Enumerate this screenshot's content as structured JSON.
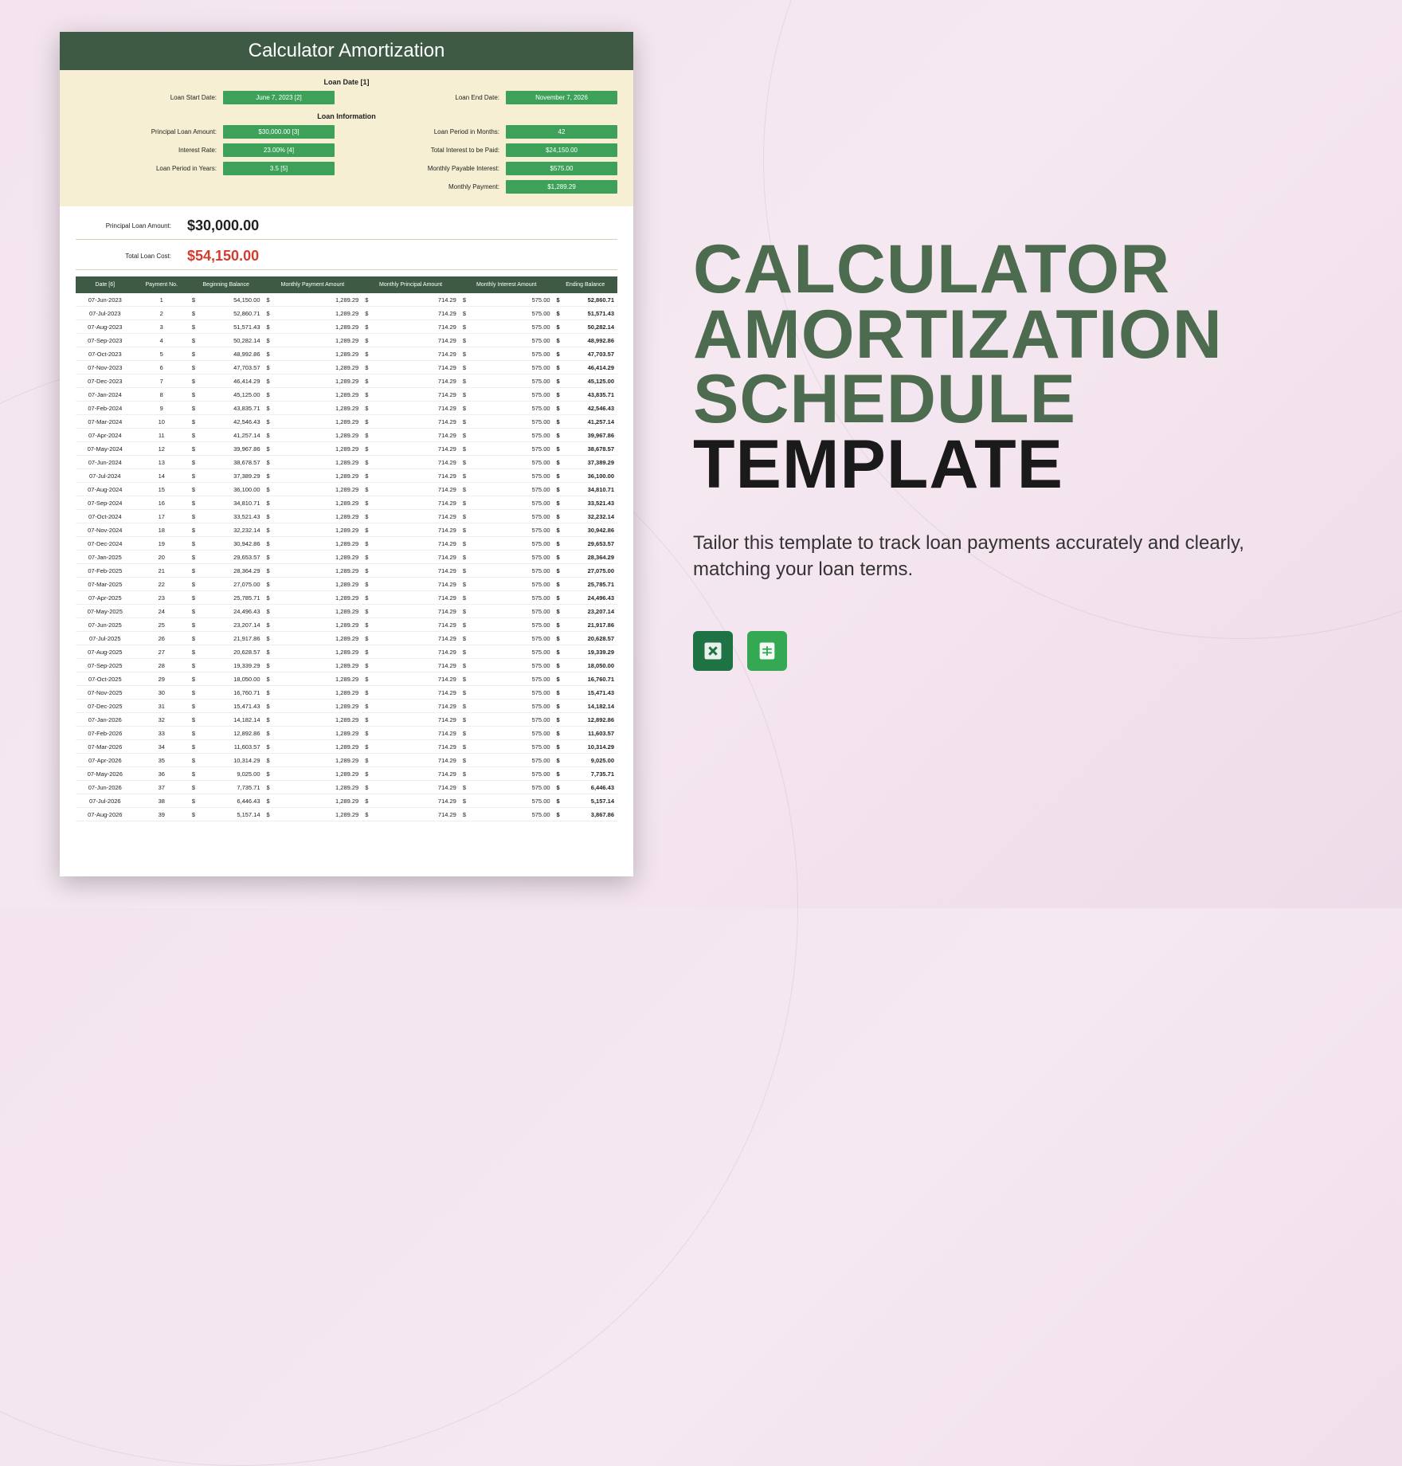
{
  "marketing": {
    "title_line1": "CALCULATOR",
    "title_line2": "AMORTIZATION",
    "title_line3": "SCHEDULE",
    "title_line4": "TEMPLATE",
    "tagline": "Tailor this template to track loan payments accurately and clearly, matching your loan terms.",
    "icons": {
      "excel": "excel-icon",
      "sheets": "google-sheets-icon"
    }
  },
  "doc": {
    "header": "Calculator Amortization",
    "loan_date_section": "Loan Date [1]",
    "loan_info_section": "Loan Information",
    "fields_left_date": {
      "label": "Loan Start Date:",
      "value": "June 7, 2023 [2]"
    },
    "fields_right_date": {
      "label": "Loan End Date:",
      "value": "November 7, 2026"
    },
    "info_left": [
      {
        "label": "Principal Loan Amount:",
        "value": "$30,000.00 [3]"
      },
      {
        "label": "Interest Rate:",
        "value": "23.00% [4]"
      },
      {
        "label": "Loan Period in Years:",
        "value": "3.5 [5]"
      }
    ],
    "info_right": [
      {
        "label": "Loan Period in Months:",
        "value": "42"
      },
      {
        "label": "Total Interest to be Paid:",
        "value": "$24,150.00"
      },
      {
        "label": "Monthly Payable Interest:",
        "value": "$575.00"
      },
      {
        "label": "Monthly Payment:",
        "value": "$1,289.29"
      }
    ],
    "summary": {
      "principal_label": "Principal Loan Amount:",
      "principal_value": "$30,000.00",
      "total_label": "Total Loan Cost:",
      "total_value": "$54,150.00"
    },
    "table": {
      "headers": [
        "Date [6]",
        "Payment No.",
        "Beginning Balance",
        "Monthly Payment Amount",
        "Monthly Principal Amount",
        "Monthly Interest Amount",
        "Ending Balance"
      ],
      "rows": [
        {
          "date": "07-Jun-2023",
          "no": 1,
          "bb": "54,150.00",
          "mp": "1,289.29",
          "mpr": "714.29",
          "mi": "575.00",
          "eb": "52,860.71"
        },
        {
          "date": "07-Jul-2023",
          "no": 2,
          "bb": "52,860.71",
          "mp": "1,289.29",
          "mpr": "714.29",
          "mi": "575.00",
          "eb": "51,571.43"
        },
        {
          "date": "07-Aug-2023",
          "no": 3,
          "bb": "51,571.43",
          "mp": "1,289.29",
          "mpr": "714.29",
          "mi": "575.00",
          "eb": "50,282.14"
        },
        {
          "date": "07-Sep-2023",
          "no": 4,
          "bb": "50,282.14",
          "mp": "1,289.29",
          "mpr": "714.29",
          "mi": "575.00",
          "eb": "48,992.86"
        },
        {
          "date": "07-Oct-2023",
          "no": 5,
          "bb": "48,992.86",
          "mp": "1,289.29",
          "mpr": "714.29",
          "mi": "575.00",
          "eb": "47,703.57"
        },
        {
          "date": "07-Nov-2023",
          "no": 6,
          "bb": "47,703.57",
          "mp": "1,289.29",
          "mpr": "714.29",
          "mi": "575.00",
          "eb": "46,414.29"
        },
        {
          "date": "07-Dec-2023",
          "no": 7,
          "bb": "46,414.29",
          "mp": "1,289.29",
          "mpr": "714.29",
          "mi": "575.00",
          "eb": "45,125.00"
        },
        {
          "date": "07-Jan-2024",
          "no": 8,
          "bb": "45,125.00",
          "mp": "1,289.29",
          "mpr": "714.29",
          "mi": "575.00",
          "eb": "43,835.71"
        },
        {
          "date": "07-Feb-2024",
          "no": 9,
          "bb": "43,835.71",
          "mp": "1,289.29",
          "mpr": "714.29",
          "mi": "575.00",
          "eb": "42,546.43"
        },
        {
          "date": "07-Mar-2024",
          "no": 10,
          "bb": "42,546.43",
          "mp": "1,289.29",
          "mpr": "714.29",
          "mi": "575.00",
          "eb": "41,257.14"
        },
        {
          "date": "07-Apr-2024",
          "no": 11,
          "bb": "41,257.14",
          "mp": "1,289.29",
          "mpr": "714.29",
          "mi": "575.00",
          "eb": "39,967.86"
        },
        {
          "date": "07-May-2024",
          "no": 12,
          "bb": "39,967.86",
          "mp": "1,289.29",
          "mpr": "714.29",
          "mi": "575.00",
          "eb": "38,678.57"
        },
        {
          "date": "07-Jun-2024",
          "no": 13,
          "bb": "38,678.57",
          "mp": "1,289.29",
          "mpr": "714.29",
          "mi": "575.00",
          "eb": "37,389.29"
        },
        {
          "date": "07-Jul-2024",
          "no": 14,
          "bb": "37,389.29",
          "mp": "1,289.29",
          "mpr": "714.29",
          "mi": "575.00",
          "eb": "36,100.00"
        },
        {
          "date": "07-Aug-2024",
          "no": 15,
          "bb": "36,100.00",
          "mp": "1,289.29",
          "mpr": "714.29",
          "mi": "575.00",
          "eb": "34,810.71"
        },
        {
          "date": "07-Sep-2024",
          "no": 16,
          "bb": "34,810.71",
          "mp": "1,289.29",
          "mpr": "714.29",
          "mi": "575.00",
          "eb": "33,521.43"
        },
        {
          "date": "07-Oct-2024",
          "no": 17,
          "bb": "33,521.43",
          "mp": "1,289.29",
          "mpr": "714.29",
          "mi": "575.00",
          "eb": "32,232.14"
        },
        {
          "date": "07-Nov-2024",
          "no": 18,
          "bb": "32,232.14",
          "mp": "1,289.29",
          "mpr": "714.29",
          "mi": "575.00",
          "eb": "30,942.86"
        },
        {
          "date": "07-Dec-2024",
          "no": 19,
          "bb": "30,942.86",
          "mp": "1,289.29",
          "mpr": "714.29",
          "mi": "575.00",
          "eb": "29,653.57"
        },
        {
          "date": "07-Jan-2025",
          "no": 20,
          "bb": "29,653.57",
          "mp": "1,289.29",
          "mpr": "714.29",
          "mi": "575.00",
          "eb": "28,364.29"
        },
        {
          "date": "07-Feb-2025",
          "no": 21,
          "bb": "28,364.29",
          "mp": "1,289.29",
          "mpr": "714.29",
          "mi": "575.00",
          "eb": "27,075.00"
        },
        {
          "date": "07-Mar-2025",
          "no": 22,
          "bb": "27,075.00",
          "mp": "1,289.29",
          "mpr": "714.29",
          "mi": "575.00",
          "eb": "25,785.71"
        },
        {
          "date": "07-Apr-2025",
          "no": 23,
          "bb": "25,785.71",
          "mp": "1,289.29",
          "mpr": "714.29",
          "mi": "575.00",
          "eb": "24,496.43"
        },
        {
          "date": "07-May-2025",
          "no": 24,
          "bb": "24,496.43",
          "mp": "1,289.29",
          "mpr": "714.29",
          "mi": "575.00",
          "eb": "23,207.14"
        },
        {
          "date": "07-Jun-2025",
          "no": 25,
          "bb": "23,207.14",
          "mp": "1,289.29",
          "mpr": "714.29",
          "mi": "575.00",
          "eb": "21,917.86"
        },
        {
          "date": "07-Jul-2025",
          "no": 26,
          "bb": "21,917.86",
          "mp": "1,289.29",
          "mpr": "714.29",
          "mi": "575.00",
          "eb": "20,628.57"
        },
        {
          "date": "07-Aug-2025",
          "no": 27,
          "bb": "20,628.57",
          "mp": "1,289.29",
          "mpr": "714.29",
          "mi": "575.00",
          "eb": "19,339.29"
        },
        {
          "date": "07-Sep-2025",
          "no": 28,
          "bb": "19,339.29",
          "mp": "1,289.29",
          "mpr": "714.29",
          "mi": "575.00",
          "eb": "18,050.00"
        },
        {
          "date": "07-Oct-2025",
          "no": 29,
          "bb": "18,050.00",
          "mp": "1,289.29",
          "mpr": "714.29",
          "mi": "575.00",
          "eb": "16,760.71"
        },
        {
          "date": "07-Nov-2025",
          "no": 30,
          "bb": "16,760.71",
          "mp": "1,289.29",
          "mpr": "714.29",
          "mi": "575.00",
          "eb": "15,471.43"
        },
        {
          "date": "07-Dec-2025",
          "no": 31,
          "bb": "15,471.43",
          "mp": "1,289.29",
          "mpr": "714.29",
          "mi": "575.00",
          "eb": "14,182.14"
        },
        {
          "date": "07-Jan-2026",
          "no": 32,
          "bb": "14,182.14",
          "mp": "1,289.29",
          "mpr": "714.29",
          "mi": "575.00",
          "eb": "12,892.86"
        },
        {
          "date": "07-Feb-2026",
          "no": 33,
          "bb": "12,892.86",
          "mp": "1,289.29",
          "mpr": "714.29",
          "mi": "575.00",
          "eb": "11,603.57"
        },
        {
          "date": "07-Mar-2026",
          "no": 34,
          "bb": "11,603.57",
          "mp": "1,289.29",
          "mpr": "714.29",
          "mi": "575.00",
          "eb": "10,314.29"
        },
        {
          "date": "07-Apr-2026",
          "no": 35,
          "bb": "10,314.29",
          "mp": "1,289.29",
          "mpr": "714.29",
          "mi": "575.00",
          "eb": "9,025.00"
        },
        {
          "date": "07-May-2026",
          "no": 36,
          "bb": "9,025.00",
          "mp": "1,289.29",
          "mpr": "714.29",
          "mi": "575.00",
          "eb": "7,735.71"
        },
        {
          "date": "07-Jun-2026",
          "no": 37,
          "bb": "7,735.71",
          "mp": "1,289.29",
          "mpr": "714.29",
          "mi": "575.00",
          "eb": "6,446.43"
        },
        {
          "date": "07-Jul-2026",
          "no": 38,
          "bb": "6,446.43",
          "mp": "1,289.29",
          "mpr": "714.29",
          "mi": "575.00",
          "eb": "5,157.14"
        },
        {
          "date": "07-Aug-2026",
          "no": 39,
          "bb": "5,157.14",
          "mp": "1,289.29",
          "mpr": "714.29",
          "mi": "575.00",
          "eb": "3,867.86"
        }
      ]
    }
  }
}
